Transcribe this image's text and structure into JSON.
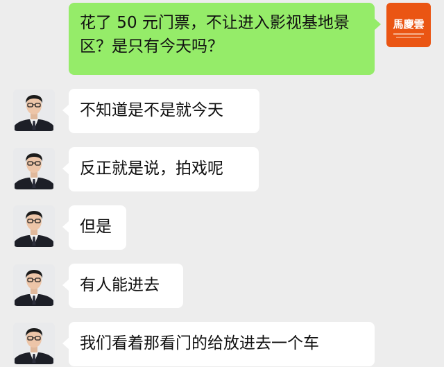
{
  "messages": [
    {
      "id": "m0",
      "sender": "self",
      "text": "花了 50 元门票，不让进入影视基地景区？是只有今天吗？"
    },
    {
      "id": "m1",
      "sender": "other",
      "text": "不知道是不是就今天"
    },
    {
      "id": "m2",
      "sender": "other",
      "text": "反正就是说，拍戏呢"
    },
    {
      "id": "m3",
      "sender": "other",
      "text": "但是"
    },
    {
      "id": "m4",
      "sender": "other",
      "text": "有人能进去"
    },
    {
      "id": "m5",
      "sender": "other",
      "text": "我们看着那看门的给放进去一个车"
    }
  ],
  "self_avatar": {
    "logo_text": "馬慶雲",
    "logo_color": "#ea5513"
  },
  "colors": {
    "background": "#ededed",
    "outgoing_bubble": "#95ec69",
    "incoming_bubble": "#ffffff"
  }
}
